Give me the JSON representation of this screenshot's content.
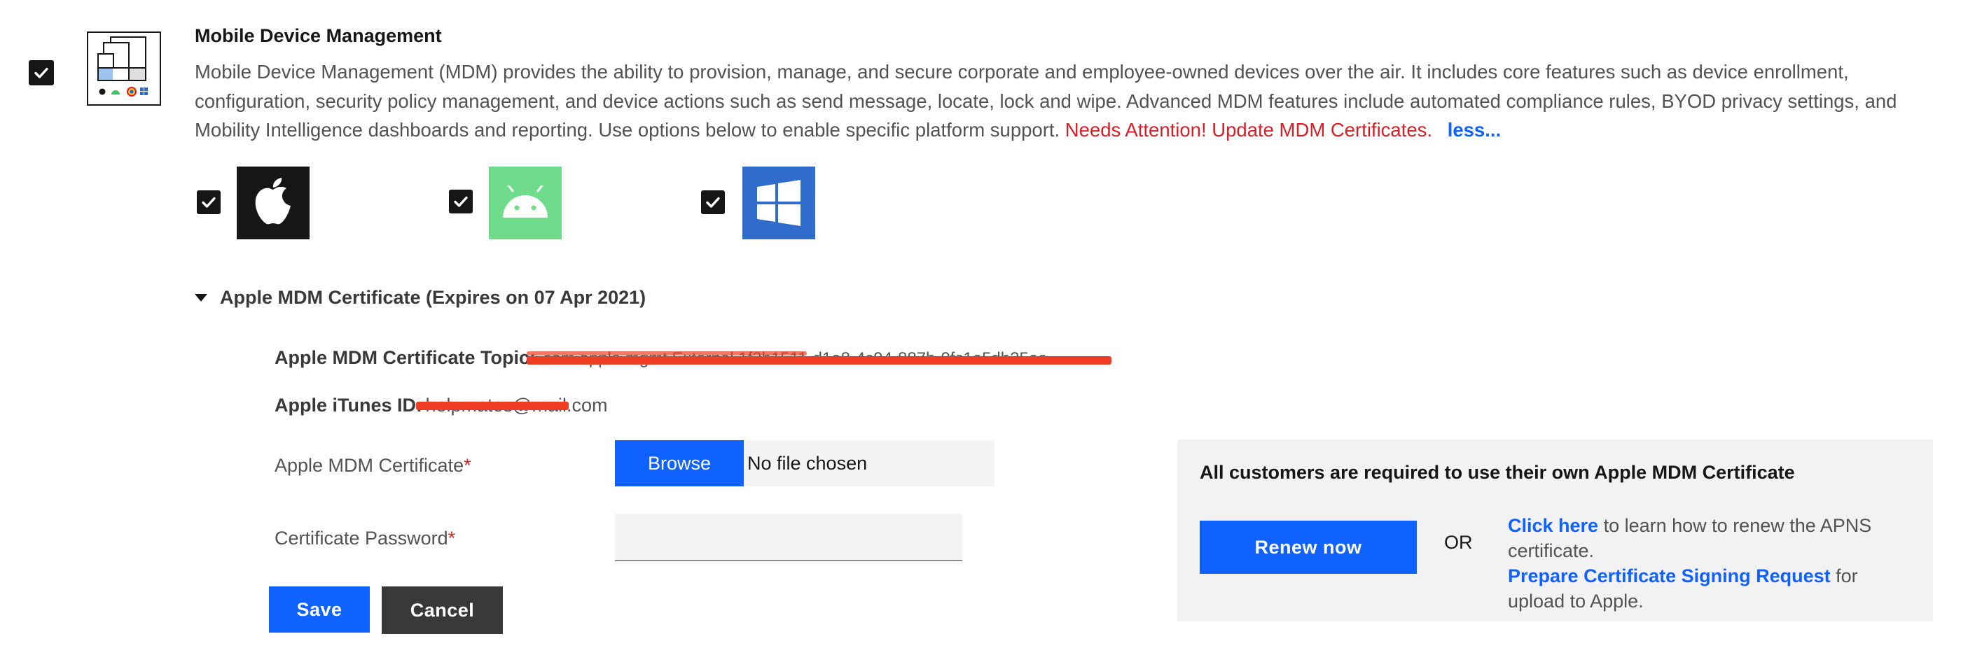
{
  "module": {
    "enabled": true,
    "title": "Mobile Device Management",
    "description": "Mobile Device Management (MDM) provides the ability to provision, manage, and secure corporate and employee-owned devices over the air. It includes core features such as device enrollment, configuration, security policy management, and device actions such as send message, locate, lock and wipe. Advanced MDM features include automated compliance rules, BYOD privacy settings, and Mobility Intelligence dashboards and reporting. Use options below to enable specific platform support.",
    "attention_text": "Needs Attention! Update MDM Certificates.",
    "less_link": "less..."
  },
  "platforms": [
    {
      "name": "apple-icon",
      "checked": true,
      "color": "#161616"
    },
    {
      "name": "android-icon",
      "checked": true,
      "color": "#6fdc8c"
    },
    {
      "name": "windows-icon",
      "checked": true,
      "color": "#2f6ccc"
    }
  ],
  "certificate_section": {
    "header": "Apple MDM Certificate (Expires on 07 Apr 2021)",
    "topic_label": "Apple MDM Certificate Topic:",
    "topic_value": "com.apple.mgmt.External.1f3b1511-d1e8-4c94-887b-0fc1e5db35ea",
    "itunes_label": "Apple iTunes ID:",
    "itunes_value": "helpmates@mail.com",
    "cert_field_label": "Apple MDM Certificate",
    "required_marker": "*",
    "browse_label": "Browse",
    "file_status": "No file chosen",
    "password_label": "Certificate Password",
    "password_value": ""
  },
  "actions": {
    "save": "Save",
    "cancel": "Cancel"
  },
  "info_panel": {
    "title": "All customers are required to use their own Apple MDM Certificate",
    "renew_button": "Renew now",
    "or_text": "OR",
    "click_here": "Click here",
    "click_here_rest": " to learn how to renew the APNS certificate.",
    "csr_link": "Prepare Certificate Signing Request",
    "csr_rest": " for upload to Apple."
  },
  "colors": {
    "primary": "#0f62fe",
    "danger": "#da1e28",
    "redaction": "#ee3d22"
  }
}
